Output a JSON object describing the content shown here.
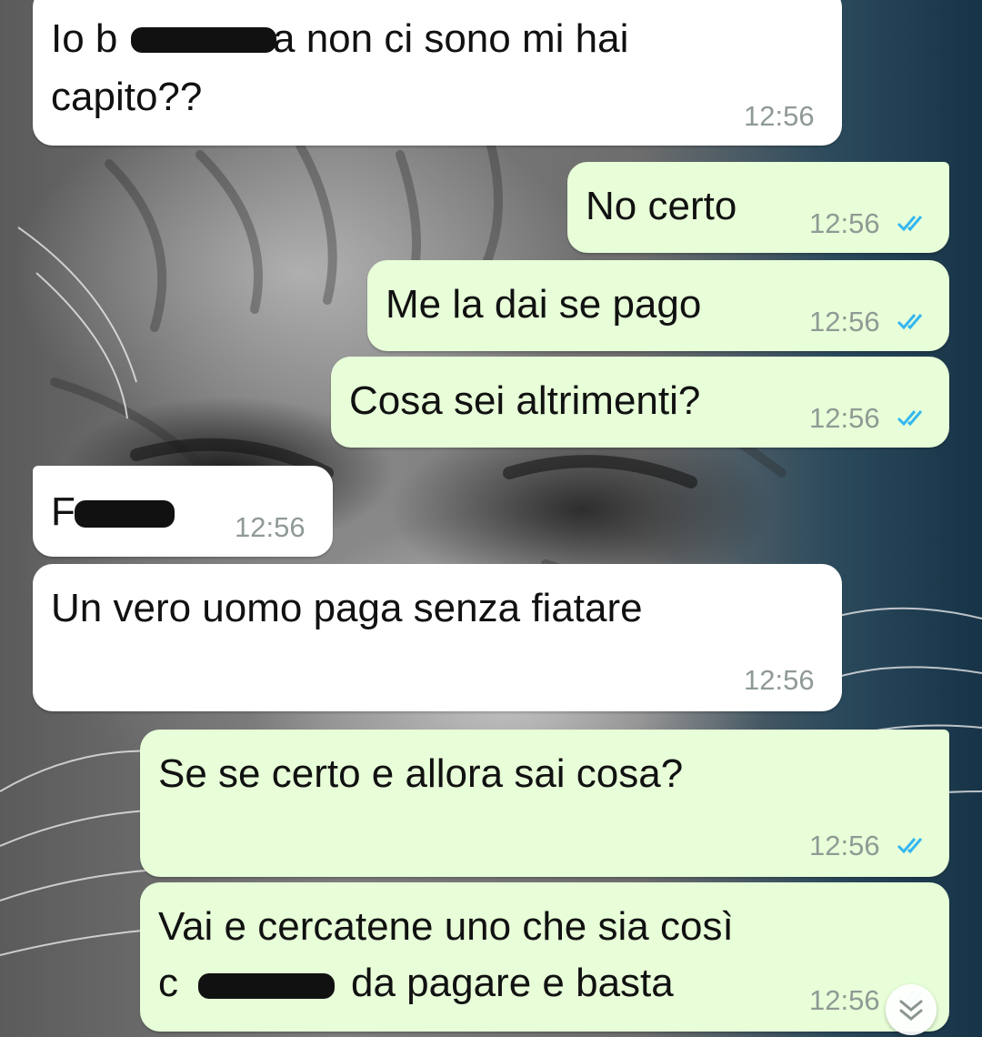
{
  "colors": {
    "incoming_bubble": "#ffffff",
    "outgoing_bubble": "#e7fed8",
    "read_ticks": "#34b7f1",
    "time_text": "#8f9a94"
  },
  "icons": {
    "read_receipt": "double-check-icon",
    "scroll_down": "double-chevron-down-icon"
  },
  "messages": [
    {
      "direction": "incoming",
      "lines": [
        "Io b",
        "a non ci sono mi hai",
        "capito??"
      ],
      "time": "12:56",
      "redacted": true
    },
    {
      "direction": "outgoing",
      "text": "No certo",
      "time": "12:56",
      "status": "read"
    },
    {
      "direction": "outgoing",
      "text": "Me la dai se pago",
      "time": "12:56",
      "status": "read"
    },
    {
      "direction": "outgoing",
      "text": "Cosa sei altrimenti?",
      "time": "12:56",
      "status": "read"
    },
    {
      "direction": "incoming",
      "text": "F",
      "time": "12:56",
      "redacted": true
    },
    {
      "direction": "incoming",
      "text": "Un vero uomo paga senza fiatare",
      "time": "12:56"
    },
    {
      "direction": "outgoing",
      "text": "Se se certo e allora sai cosa?",
      "time": "12:56",
      "status": "read"
    },
    {
      "direction": "outgoing",
      "lines": [
        "Vai e cercatene uno che sia così",
        "c",
        "da pagare e basta"
      ],
      "time": "12:56",
      "status": "read",
      "redacted": true
    }
  ]
}
